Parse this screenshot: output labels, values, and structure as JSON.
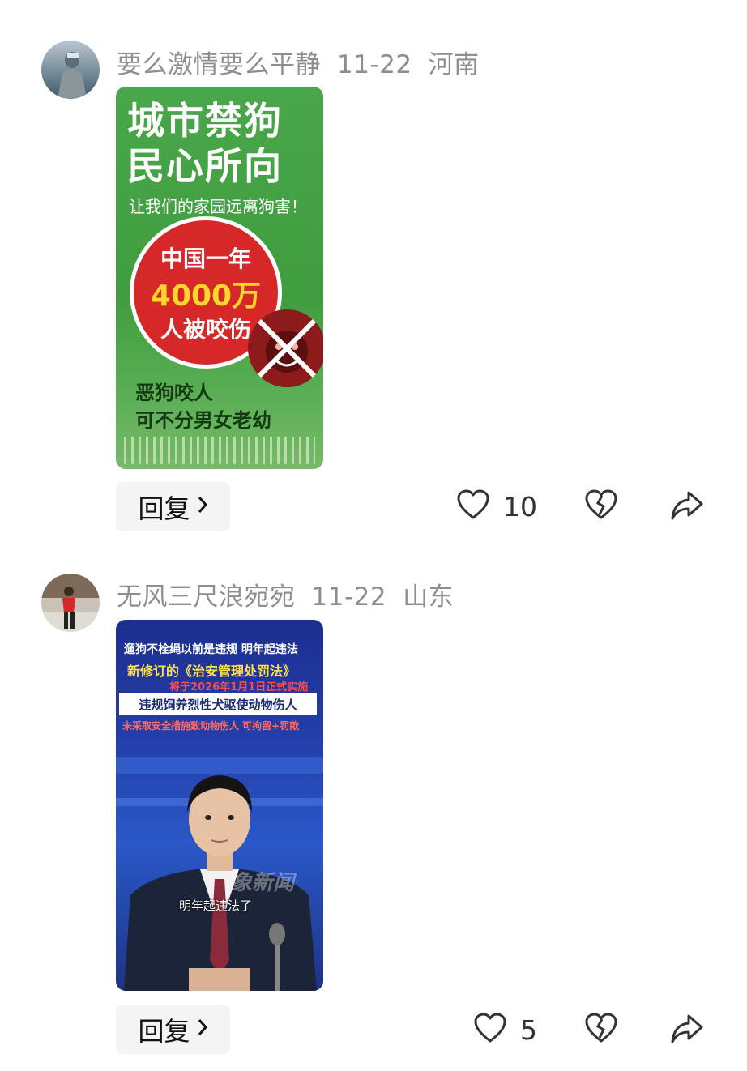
{
  "comments": [
    {
      "username": "要么激情要么平静",
      "date": "11-22",
      "location": "河南",
      "poster": {
        "title_line1": "城市禁狗",
        "title_line2": "民心所向",
        "subtitle": "让我们的家园远离狗害！",
        "circle_line1": "中国一年",
        "circle_line2": "4000万",
        "circle_line3": "人被咬伤",
        "footer_line1": "恶狗咬人",
        "footer_line2": "可不分男女老幼"
      },
      "reply_label": "回复",
      "like_count": "10"
    },
    {
      "username": "无风三尺浪宛宛",
      "date": "11-22",
      "location": "山东",
      "poster": {
        "line1": "遛狗不栓绳以前是违规 明年起违法",
        "line2": "新修订的《治安管理处罚法》",
        "line3": "将于2026年1月1日正式实施",
        "box": "违规饲养烈性犬驱使动物伤人",
        "line4": "未采取安全措施致动物伤人 可拘留+罚款",
        "watermark": "象新闻",
        "caption": "明年起违法了"
      },
      "reply_label": "回复",
      "like_count": "5"
    }
  ],
  "icons": {
    "like": "heart-outline-icon",
    "dislike": "broken-heart-icon",
    "share": "share-arrow-icon",
    "chevron": "chevron-right-icon"
  },
  "colors": {
    "meta_text": "#8e8e8e",
    "reply_bg": "#f4f4f4",
    "icon_stroke": "#333333"
  }
}
